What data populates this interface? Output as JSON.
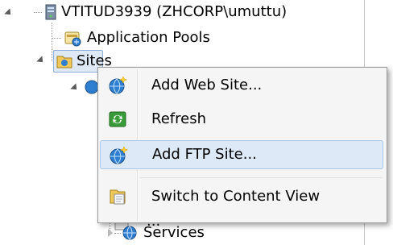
{
  "tree": {
    "server_label": "VTITUD3939 (ZHCORP\\umuttu)",
    "app_pools_label": "Application Pools",
    "sites_label": "Sites",
    "partial_label": "...",
    "services_label": "Services"
  },
  "context_menu": {
    "items": [
      {
        "label": "Add Web Site...",
        "icon": "globe-add-icon"
      },
      {
        "label": "Refresh",
        "icon": "refresh-icon"
      },
      {
        "label": "Add FTP Site...",
        "icon": "globe-add-icon",
        "highlighted": true
      },
      {
        "label": "Switch to Content View",
        "icon": "content-view-icon"
      }
    ]
  },
  "colors": {
    "selection": "#dfe9f5",
    "menu_background": "#f5f5f5",
    "menu_hover": "#dde9f6",
    "globe": "#2e7fd1",
    "refresh": "#3a9b3a"
  }
}
